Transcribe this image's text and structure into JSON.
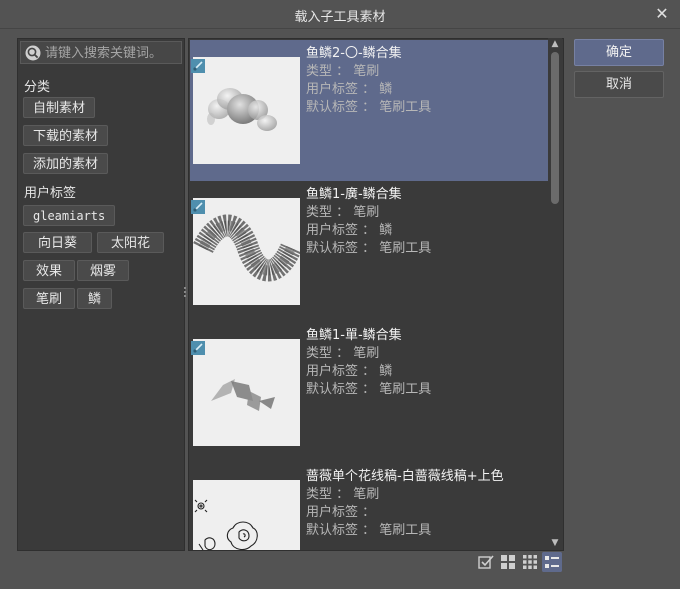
{
  "window": {
    "title": "载入子工具素材",
    "close_glyph": "✕"
  },
  "search": {
    "placeholder": "请键入搜索关键词。"
  },
  "sidebar": {
    "category_label": "分类",
    "categories": [
      "自制素材",
      "下载的素材",
      "添加的素材"
    ],
    "user_tags_label": "用户标签",
    "user_tags": [
      "gleamiarts",
      "向日葵",
      "太阳花",
      "效果",
      "烟雾",
      "笔刷",
      "鳞"
    ]
  },
  "list": {
    "items": [
      {
        "title": "鱼鳞2-〇-鳞合集",
        "type_label": "类型 ： 笔刷",
        "user_tag_label": "用户标签 ： 鳞",
        "default_tag_label": "默认标签 ： 笔刷工具",
        "selected": true
      },
      {
        "title": "鱼鳞1-廣-鳞合集",
        "type_label": "类型 ： 笔刷",
        "user_tag_label": "用户标签 ： 鳞",
        "default_tag_label": "默认标签 ： 笔刷工具",
        "selected": false
      },
      {
        "title": "鱼鳞1-單-鳞合集",
        "type_label": "类型 ： 笔刷",
        "user_tag_label": "用户标签 ： 鳞",
        "default_tag_label": "默认标签 ： 笔刷工具",
        "selected": false
      },
      {
        "title": "蔷薇单个花线稿-白蔷薇线稿+上色",
        "type_label": "类型 ： 笔刷",
        "user_tag_label": "用户标签 ：",
        "default_tag_label": "默认标签 ： 笔刷工具",
        "selected": false
      }
    ]
  },
  "buttons": {
    "ok": "确定",
    "cancel": "取消"
  },
  "view_modes": [
    "checkbox-view-icon",
    "large-grid-icon",
    "small-grid-icon",
    "detail-list-icon"
  ],
  "colors": {
    "accent": "#5f6a8c",
    "panel": "#3a3a3a",
    "background": "#535353"
  }
}
